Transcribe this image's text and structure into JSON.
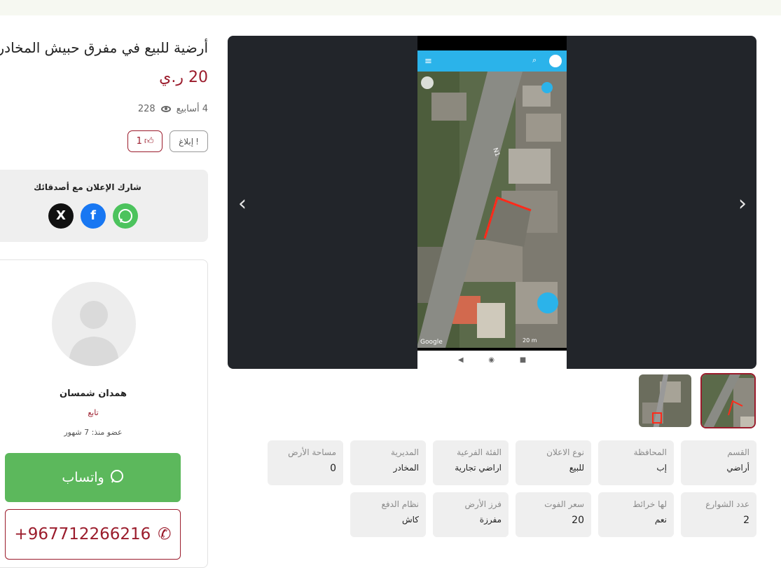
{
  "listing": {
    "title": "أرضية للبيع في مفرق حبيش المخادر",
    "price": "20 ر.ي",
    "age": "4 أسابيع",
    "views": "228",
    "report_label": "إبلاغ",
    "likes": "1"
  },
  "share": {
    "heading": "شارك الإعلان مع أصدقائك",
    "x_icon": "X",
    "facebook_icon": "f"
  },
  "seller": {
    "name": "همدان شمسان",
    "follow_label": "تابع",
    "member_since": "عضو منذ: 7 شهور",
    "whatsapp_label": "واتساب",
    "phone": "+967712266216"
  },
  "map": {
    "brand": "Google",
    "scale": "20 m",
    "road_label": "N1"
  },
  "specs": [
    {
      "label": "القسم",
      "value": "أراضي"
    },
    {
      "label": "المحافظة",
      "value": "إب"
    },
    {
      "label": "نوع الاعلان",
      "value": "للبيع"
    },
    {
      "label": "الفئة الفرعية",
      "value": "اراضي تجارية"
    },
    {
      "label": "المديرية",
      "value": "المخادر"
    },
    {
      "label": "مساحة الأرض",
      "value": "0"
    },
    {
      "label": "عدد الشوارع",
      "value": "2"
    },
    {
      "label": "لها خرائط",
      "value": "نعم"
    },
    {
      "label": "سعر الفوت",
      "value": "20"
    },
    {
      "label": "فرز الأرض",
      "value": "مفرزة"
    },
    {
      "label": "نظام الدفع",
      "value": "كاش"
    }
  ],
  "colors": {
    "accent": "#9b1c2c",
    "whatsapp": "#5cb85c",
    "facebook": "#1877f2",
    "card": "#efefef"
  }
}
